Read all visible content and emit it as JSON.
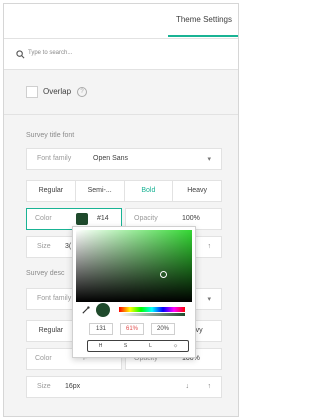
{
  "header": {
    "title": "Theme Settings",
    "accent": "#19b394"
  },
  "search": {
    "placeholder": "Type to search..."
  },
  "overlap": {
    "label": "Overlap",
    "checked": false
  },
  "survey_title_font": {
    "section_title": "Survey title font",
    "font_family_caption": "Font family",
    "font_family_value": "Open Sans",
    "weights": [
      "Regular",
      "Semi-...",
      "Bold",
      "Heavy"
    ],
    "active_weight": "Bold",
    "color_caption": "Color",
    "color_value": "#14",
    "opacity_caption": "Opacity",
    "opacity_value": "100%",
    "size_caption": "Size",
    "size_value": "3("
  },
  "survey_description_font": {
    "section_title": "Survey desc",
    "font_family_caption": "Font family",
    "weights": [
      "Regular",
      "",
      "",
      "avy"
    ],
    "color_caption": "Color",
    "color_value": "F",
    "opacity_caption": "Opacity",
    "opacity_value": "100%",
    "size_caption": "Size",
    "size_value": "16px"
  },
  "picker": {
    "hue_value": "131",
    "saturation_value": "61%",
    "lightness_value": "20%",
    "mode_labels": [
      "H",
      "S",
      "L",
      "⬦"
    ],
    "current_color": "#1f4a2c"
  }
}
